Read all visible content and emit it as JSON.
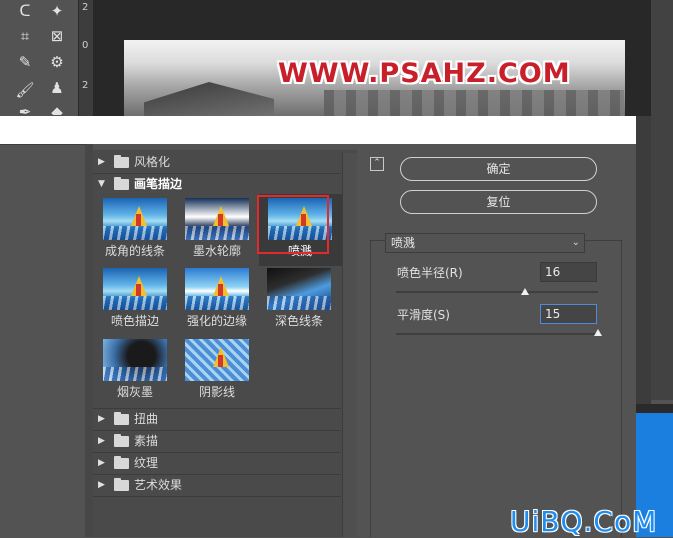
{
  "toolbar": {
    "ruler_marks": [
      "2",
      "0",
      "2"
    ],
    "tools": [
      {
        "name": "lasso-icon",
        "glyph": "ᑕ"
      },
      {
        "name": "magic-wand-icon",
        "glyph": "✦"
      },
      {
        "name": "crop-icon",
        "glyph": "⌗"
      },
      {
        "name": "frame-icon",
        "glyph": "⊠"
      },
      {
        "name": "eyedropper-icon",
        "glyph": "✎"
      },
      {
        "name": "spot-healing-icon",
        "glyph": "⚙"
      },
      {
        "name": "brush-icon",
        "glyph": "🖌"
      },
      {
        "name": "stamp-icon",
        "glyph": "♟"
      }
    ]
  },
  "canvas": {
    "watermark": "WWW.PSAHZ.COM"
  },
  "categories": [
    {
      "id": "stylize",
      "label": "风格化",
      "open": false
    },
    {
      "id": "brush-strokes",
      "label": "画笔描边",
      "open": true
    },
    {
      "id": "distort",
      "label": "扭曲",
      "open": false
    },
    {
      "id": "sketch",
      "label": "素描",
      "open": false
    },
    {
      "id": "texture",
      "label": "纹理",
      "open": false
    },
    {
      "id": "artistic",
      "label": "艺术效果",
      "open": false
    }
  ],
  "thumbnails": [
    {
      "label": "成角的线条",
      "style": ""
    },
    {
      "label": "墨水轮廓",
      "style": "inked"
    },
    {
      "label": "喷溅",
      "style": "",
      "selected": true
    },
    {
      "label": "喷色描边",
      "style": ""
    },
    {
      "label": "强化的边缘",
      "style": "accent"
    },
    {
      "label": "深色线条",
      "style": "dark-ink"
    },
    {
      "label": "烟灰墨",
      "style": "smoky"
    },
    {
      "label": "阴影线",
      "style": "hatch"
    }
  ],
  "buttons": {
    "ok": "确定",
    "reset": "复位"
  },
  "filter_select": {
    "value": "喷溅"
  },
  "params": [
    {
      "label": "喷色半径(R)",
      "value": "16",
      "level": 0.64
    },
    {
      "label": "平滑度(S)",
      "value": "15",
      "level": 1.0
    }
  ],
  "footer_watermark": "UiBQ.CoM",
  "colors": {
    "selection_border": "#e2292b",
    "focus_border": "#4d8cdc",
    "watermark_red": "#c8202a",
    "accent_blue": "#1a7fdf"
  }
}
